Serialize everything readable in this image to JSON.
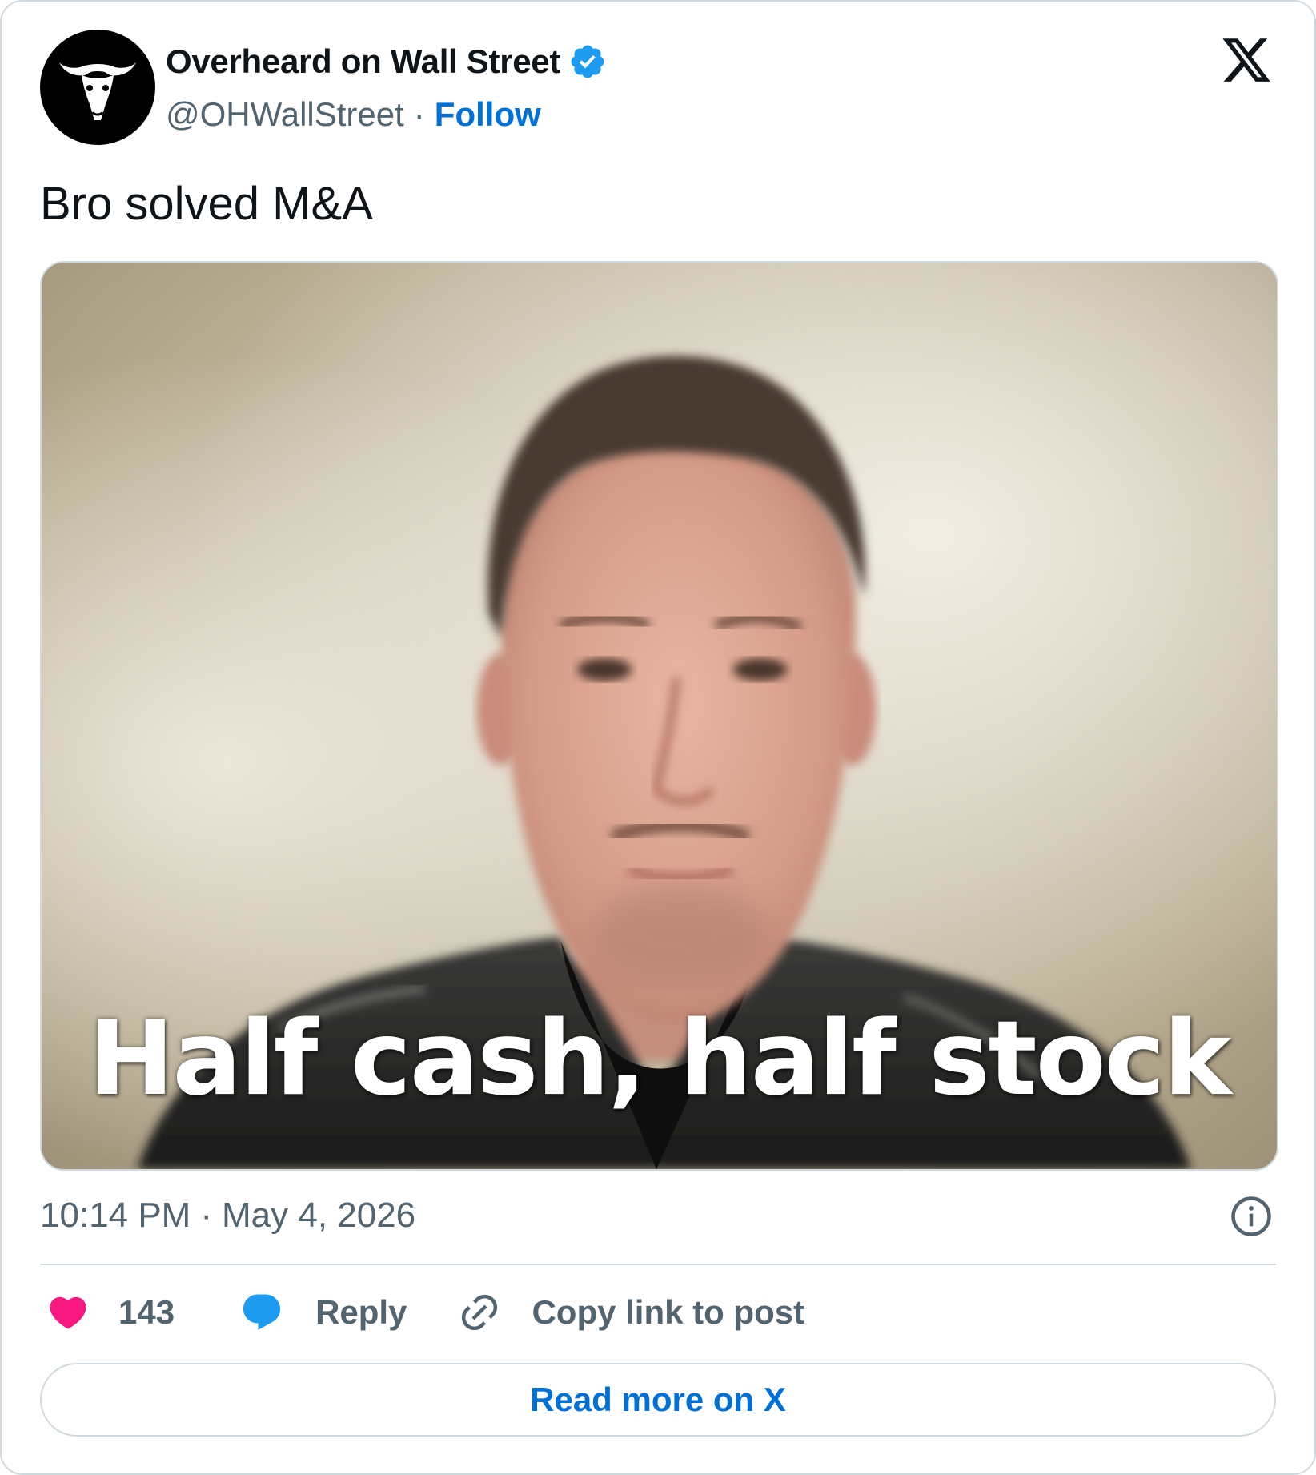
{
  "author": {
    "display_name": "Overheard on Wall Street",
    "handle": "@OHWallStreet",
    "separator": "·",
    "follow_label": "Follow",
    "avatar_icon": "bull-skull-icon",
    "verified_icon": "verified-badge-icon"
  },
  "brand": {
    "logo_icon": "x-logo-icon"
  },
  "tweet": {
    "text": "Bro solved M&A",
    "media": {
      "caption": "Half cash, half stock"
    }
  },
  "meta": {
    "time": "10:14 PM",
    "separator": "·",
    "date": "May 4, 2026",
    "info_icon": "info-icon"
  },
  "actions": {
    "like_icon": "heart-icon",
    "like_count": "143",
    "reply_icon": "speech-bubble-icon",
    "reply_label": "Reply",
    "copy_icon": "link-icon",
    "copy_label": "Copy link to post"
  },
  "footer": {
    "read_more_label": "Read more on X"
  },
  "colors": {
    "link_blue": "#006fd6",
    "muted_text": "#536471",
    "border": "#cfd9de",
    "like_pink": "#f91880",
    "reply_blue": "#1d9bf0",
    "verified_blue": "#1d9bf0"
  }
}
